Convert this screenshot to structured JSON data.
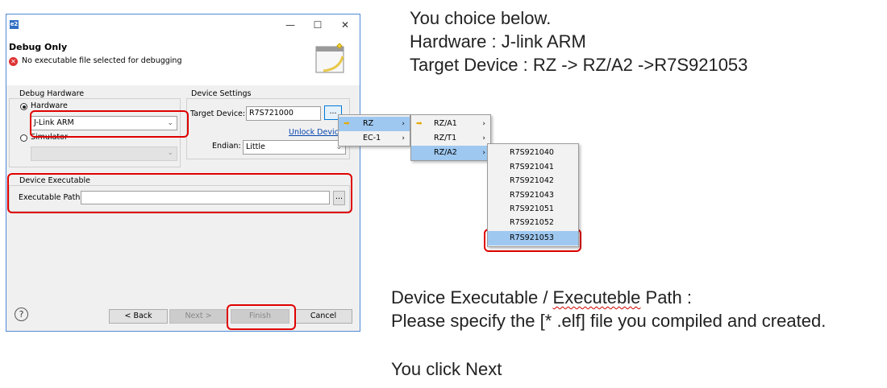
{
  "dialog": {
    "app_icon": "e2",
    "window_buttons": {
      "minimize": "—",
      "maximize": "☐",
      "close": "✕"
    },
    "title": "Debug Only",
    "error_message": "No executable file selected for debugging",
    "debug_hardware": {
      "group_label": "Debug Hardware",
      "hardware_label": "Hardware",
      "hardware_selected": true,
      "hardware_value": "J-Link ARM",
      "simulator_label": "Simulator",
      "simulator_value": ""
    },
    "device_settings": {
      "group_label": "Device Settings",
      "target_device_label": "Target Device:",
      "target_device_value": "R7S721000",
      "browse_label": "...",
      "unlock_devices": "Unlock Devices...",
      "endian_label": "Endian:",
      "endian_value": "Little"
    },
    "device_executable": {
      "group_label": "Device Executable",
      "path_label": "Executable Path:",
      "path_value": "",
      "browse_label": "..."
    },
    "buttons": {
      "help": "?",
      "back": "< Back",
      "next": "Next >",
      "finish": "Finish",
      "cancel": "Cancel"
    }
  },
  "menus": {
    "level1": [
      {
        "label": "RZ",
        "selected": true
      },
      {
        "label": "EC-1",
        "selected": false
      }
    ],
    "level2": [
      {
        "label": "RZ/A1",
        "selected": false
      },
      {
        "label": "RZ/T1",
        "selected": false
      },
      {
        "label": "RZ/A2",
        "selected": true
      }
    ],
    "level3": [
      "R7S921040",
      "R7S921041",
      "R7S921042",
      "R7S921043",
      "R7S921051",
      "R7S921052",
      "R7S921053"
    ],
    "level3_selected": "R7S921053"
  },
  "notes": {
    "top": [
      "You choice below.",
      "Hardware : J-link ARM",
      "Target Device : RZ -> RZ/A2 ->R7S921053"
    ],
    "bottom_line1_part1": "Device Executable / ",
    "bottom_line1_part2": "Executeble",
    "bottom_line1_part3": " Path :",
    "bottom_line2": "Please specify the [* .elf] file you compiled and created.",
    "bottom_line3": "You click Next"
  },
  "colors": {
    "highlight_border": "#e00000",
    "selection": "#9fc8f0",
    "window_border": "#4f8ad6"
  }
}
